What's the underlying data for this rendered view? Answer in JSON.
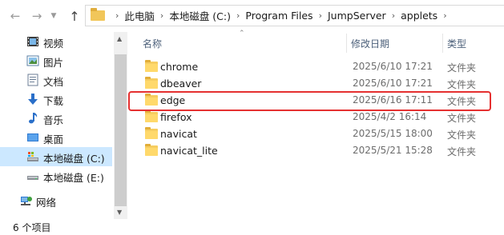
{
  "breadcrumb": [
    "此电脑",
    "本地磁盘 (C:)",
    "Program Files",
    "JumpServer",
    "applets"
  ],
  "sidebar": {
    "items": [
      {
        "label": "视频",
        "icon": "video-icon"
      },
      {
        "label": "图片",
        "icon": "pictures-icon"
      },
      {
        "label": "文档",
        "icon": "documents-icon"
      },
      {
        "label": "下载",
        "icon": "download-icon"
      },
      {
        "label": "音乐",
        "icon": "music-icon"
      },
      {
        "label": "桌面",
        "icon": "desktop-icon"
      },
      {
        "label": "本地磁盘 (C:)",
        "icon": "drive-c-icon",
        "selected": true
      },
      {
        "label": "本地磁盘 (E:)",
        "icon": "drive-e-icon"
      },
      {
        "label": "网络",
        "icon": "network-icon"
      }
    ]
  },
  "columns": {
    "name": "名称",
    "date": "修改日期",
    "type": "类型"
  },
  "files": [
    {
      "name": "chrome",
      "date": "2025/6/10 17:21",
      "type": "文件夹"
    },
    {
      "name": "dbeaver",
      "date": "2025/6/10 17:21",
      "type": "文件夹"
    },
    {
      "name": "edge",
      "date": "2025/6/16 17:11",
      "type": "文件夹",
      "highlighted": true
    },
    {
      "name": "firefox",
      "date": "2025/4/2 16:14",
      "type": "文件夹"
    },
    {
      "name": "navicat",
      "date": "2025/5/15 18:00",
      "type": "文件夹"
    },
    {
      "name": "navicat_lite",
      "date": "2025/5/21 15:28",
      "type": "文件夹"
    }
  ],
  "status": {
    "item_count": "6 个项目"
  },
  "colors": {
    "selection": "#cce8ff",
    "highlight_box": "#e53030",
    "folder": "#f6cd60"
  }
}
